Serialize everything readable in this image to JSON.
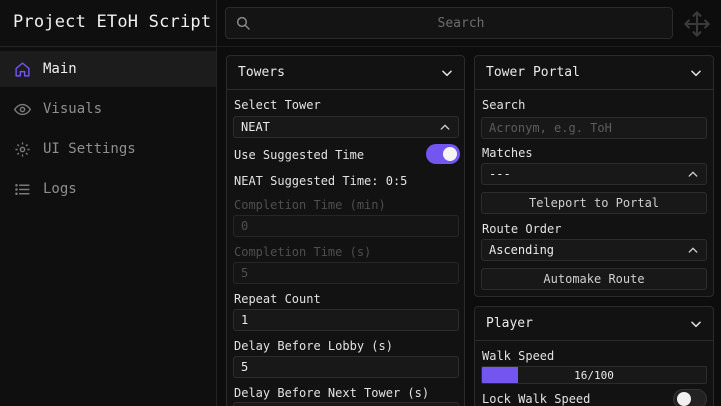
{
  "app": {
    "title": "Project EToH Script"
  },
  "search": {
    "placeholder": "Search"
  },
  "sidebar": {
    "items": [
      {
        "label": "Main",
        "icon": "home-icon",
        "active": true
      },
      {
        "label": "Visuals",
        "icon": "eye-icon",
        "active": false
      },
      {
        "label": "UI Settings",
        "icon": "gear-icon",
        "active": false
      },
      {
        "label": "Logs",
        "icon": "list-icon",
        "active": false
      }
    ]
  },
  "colors": {
    "accent": "#7356f0",
    "background": "#0d0d0d",
    "panel": "#121212"
  },
  "towers": {
    "title": "Towers",
    "select_tower_label": "Select Tower",
    "select_tower_value": "NEAT",
    "use_suggested_label": "Use Suggested Time",
    "use_suggested_on": true,
    "suggested_time_text": "NEAT Suggested Time: 0:5",
    "completion_min_label": "Completion Time (min)",
    "completion_min_value": "0",
    "completion_s_label": "Completion Time (s)",
    "completion_s_value": "5",
    "repeat_count_label": "Repeat Count",
    "repeat_count_value": "1",
    "delay_lobby_label": "Delay Before Lobby (s)",
    "delay_lobby_value": "5",
    "delay_next_label": "Delay Before Next Tower (s)"
  },
  "portal": {
    "title": "Tower Portal",
    "search_label": "Search",
    "search_placeholder": "Acronym, e.g. ToH",
    "matches_label": "Matches",
    "matches_value": "---",
    "teleport_label": "Teleport to Portal",
    "route_order_label": "Route Order",
    "route_order_value": "Ascending",
    "automake_label": "Automake Route"
  },
  "player": {
    "title": "Player",
    "walk_speed_label": "Walk Speed",
    "walk_speed_value": 16,
    "walk_speed_max": 100,
    "walk_speed_text": "16/100",
    "lock_walk_label": "Lock Walk Speed",
    "lock_walk_on": false
  }
}
